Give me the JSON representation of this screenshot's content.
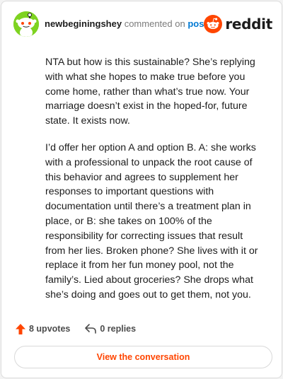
{
  "header": {
    "username": "newbeginingshey",
    "action_text": "commented on",
    "post_link": "post",
    "brand_name": "reddit"
  },
  "comment": {
    "paragraphs": [
      "NTA but how is this sustainable? She’s replying with what she hopes to make true before you come home, rather than what’s true now. Your marriage doesn’t exist in the hoped-for, future state. It exists now.",
      "I’d offer her option A and option B. A: she works with a professional to unpack the root cause of this behavior and agrees to supplement her responses to important questions with documentation until there’s a treatment plan in place, or B: she takes on 100% of the responsibility for correcting issues that result from her lies. Broken phone? She lives with it or replace it from her fun money pool, not the family’s. Lied about groceries? She drops what she’s doing and goes out to get them, not you."
    ]
  },
  "footer": {
    "upvotes_label": "8 upvotes",
    "replies_label": "0 replies",
    "view_button_label": "View the conversation"
  },
  "icons": {
    "avatar": "snoo-avatar-icon",
    "brand": "reddit-logo-icon",
    "upvote": "upvote-arrow-icon",
    "reply": "reply-arrow-icon"
  },
  "colors": {
    "accent": "#ff4500",
    "link": "#0079d3",
    "avatar_bg": "#7ed321",
    "text": "#1c1c1c",
    "muted": "#7c7c7c"
  }
}
